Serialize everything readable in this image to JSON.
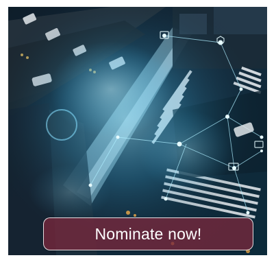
{
  "hero": {
    "image": "night-city-intersection-with-network-connections",
    "cta_label": "Nominate now!"
  },
  "colors": {
    "overlay": "#7a2a40",
    "border": "#ffffff",
    "glow": "#4fd3ff"
  }
}
